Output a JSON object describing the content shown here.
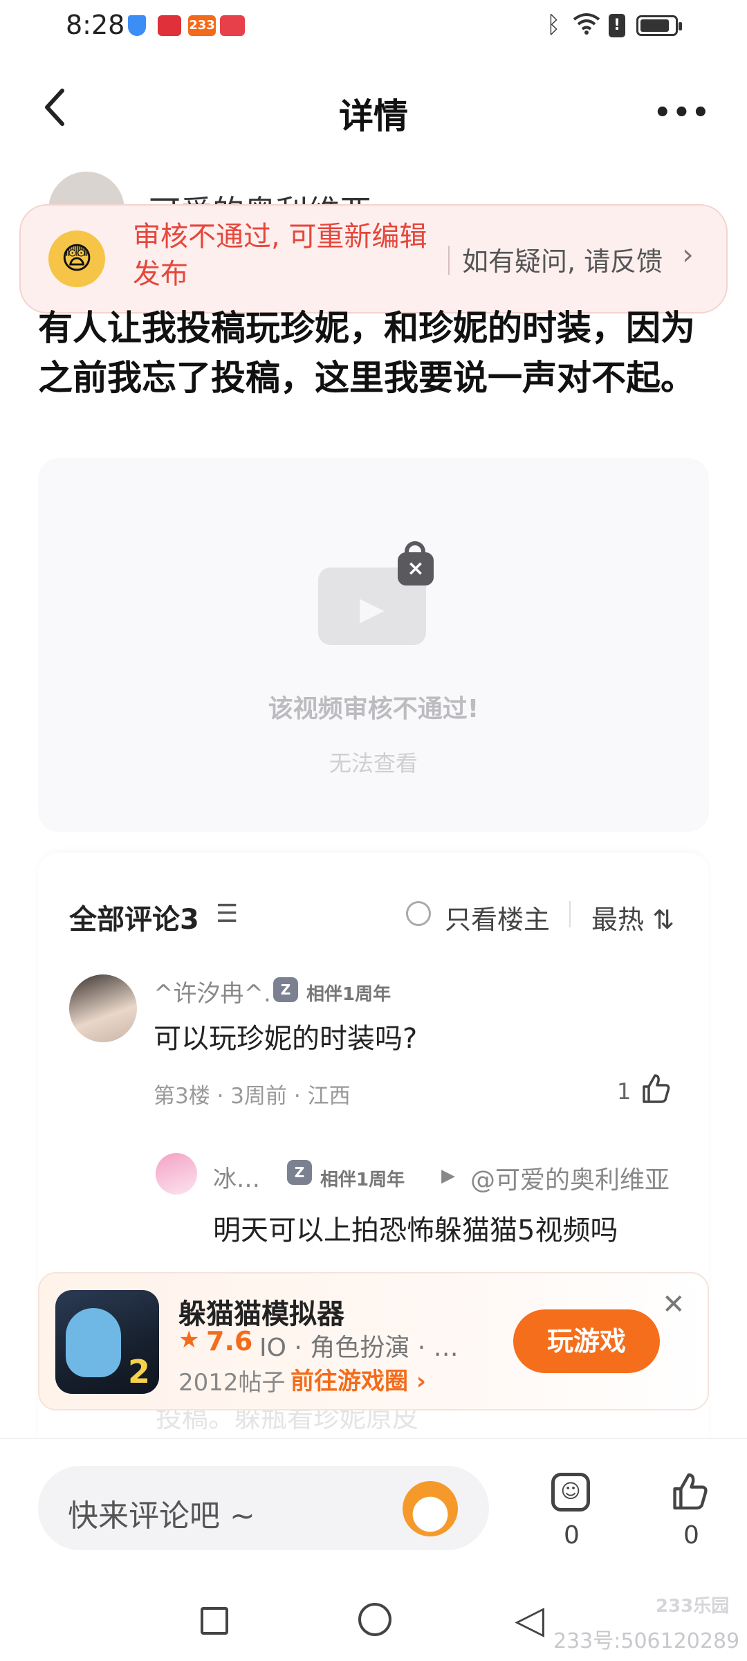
{
  "status_bar": {
    "time": "8:28",
    "icons": [
      "shield-icon",
      "book-icon",
      "233-app-icon",
      "shop-icon",
      "bluetooth-icon",
      "wifi-icon",
      "alert-icon",
      "battery-icon"
    ],
    "app_badge": "233"
  },
  "header": {
    "title": "详情",
    "more": "•••"
  },
  "author": {
    "name": "可爱的奥利维亚"
  },
  "banner": {
    "message": "审核不通过, 可重新编辑发布",
    "feedback": "如有疑问, 请反馈",
    "chevron": "›"
  },
  "post": {
    "body": "有人让我投稿玩珍妮，和珍妮的时装，因为之前我忘了投稿，这里我要说一声对不起。"
  },
  "video": {
    "title": "该视频审核不通过!",
    "subtitle": "无法查看"
  },
  "comments": {
    "title": "全部评论3",
    "only_owner": "只看楼主",
    "sort": "最热 ⇅",
    "items": [
      {
        "name": "^许汐冉^.",
        "badge": "相伴1周年",
        "text": "可以玩珍妮的时装吗?",
        "meta": "第3楼 · 3周前 · 江西",
        "likes": "1"
      }
    ],
    "reply": {
      "name": "冰…",
      "badge": "相伴1周年",
      "reply_to": "@可爱的奥利维亚",
      "text": "明天可以上拍恐怖躲猫猫5视频吗"
    },
    "hidden_text": "投稿。躲瓶看珍妮原皮"
  },
  "game_card": {
    "name": "躲猫猫模拟器",
    "star": "★",
    "rating": "7.6",
    "tags": "IO · 角色扮演 · …",
    "posts": "2012帖子",
    "circle_link": "前往游戏圈 ›",
    "play": "玩游戏",
    "close": "✕",
    "icon_number": "2"
  },
  "bottom_bar": {
    "placeholder": "快来评论吧 ~",
    "comment_count": "0",
    "like_count": "0"
  },
  "watermark": {
    "text": "233号:506120289",
    "logo": "233乐园"
  },
  "colors": {
    "accent": "#f56e1c",
    "banner_text": "#e5473c",
    "banner_bg": "#fdefee"
  }
}
